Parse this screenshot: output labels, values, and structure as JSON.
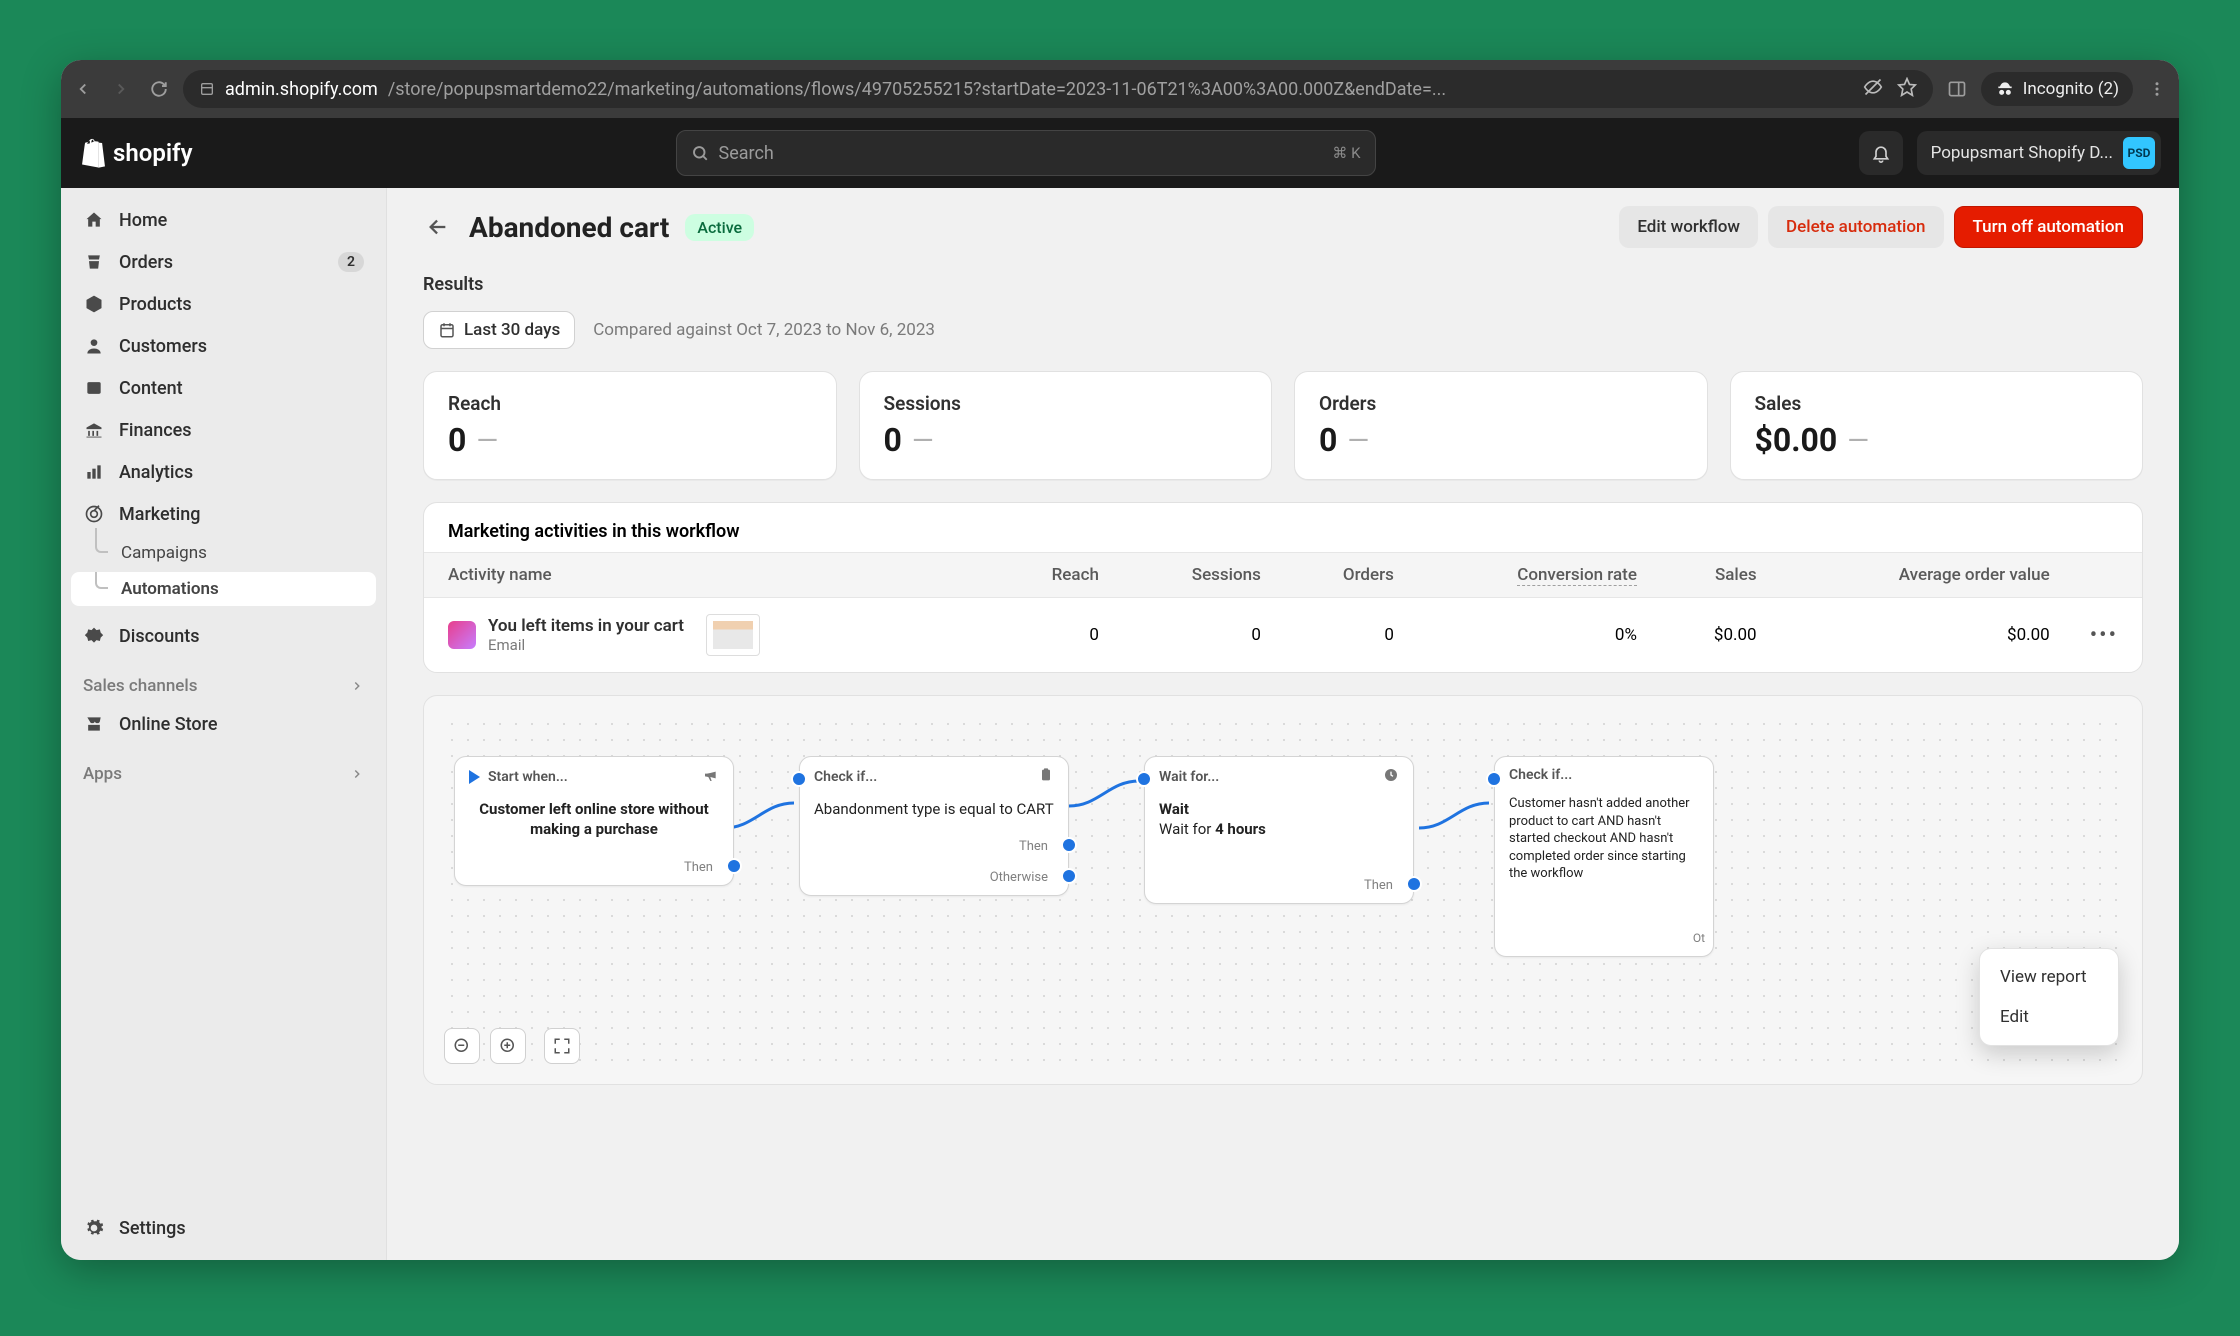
{
  "browser": {
    "url_host": "admin.shopify.com",
    "url_path": "/store/popupsmartdemo22/marketing/automations/flows/49705255215?startDate=2023-11-06T21%3A00%3A00.000Z&endDate=...",
    "incognito": "Incognito (2)"
  },
  "topbar": {
    "logo_text": "shopify",
    "search_placeholder": "Search",
    "shortcut": "⌘ K",
    "store_name": "Popupsmart Shopify D...",
    "store_initials": "PSD"
  },
  "sidebar": {
    "items": [
      {
        "label": "Home"
      },
      {
        "label": "Orders",
        "badge": "2"
      },
      {
        "label": "Products"
      },
      {
        "label": "Customers"
      },
      {
        "label": "Content"
      },
      {
        "label": "Finances"
      },
      {
        "label": "Analytics"
      },
      {
        "label": "Marketing",
        "children": [
          {
            "label": "Campaigns"
          },
          {
            "label": "Automations",
            "active": true
          }
        ]
      },
      {
        "label": "Discounts"
      }
    ],
    "sales_channels_label": "Sales channels",
    "online_store": "Online Store",
    "apps_label": "Apps",
    "settings": "Settings"
  },
  "page": {
    "title": "Abandoned cart",
    "status": "Active",
    "actions": {
      "edit": "Edit workflow",
      "delete": "Delete automation",
      "turn_off": "Turn off automation"
    },
    "results_label": "Results",
    "date_filter": "Last 30 days",
    "compare_text": "Compared against Oct 7, 2023 to Nov 6, 2023",
    "metrics": [
      {
        "title": "Reach",
        "value": "0"
      },
      {
        "title": "Sessions",
        "value": "0"
      },
      {
        "title": "Orders",
        "value": "0"
      },
      {
        "title": "Sales",
        "value": "$0.00"
      }
    ],
    "activities": {
      "title": "Marketing activities in this workflow",
      "columns": [
        "Activity name",
        "Reach",
        "Sessions",
        "Orders",
        "Conversion rate",
        "Sales",
        "Average order value"
      ],
      "rows": [
        {
          "name": "You left items in your cart",
          "sub": "Email",
          "reach": "0",
          "sessions": "0",
          "orders": "0",
          "conversion": "0%",
          "sales": "$0.00",
          "aov": "$0.00"
        }
      ]
    },
    "popup": {
      "view_report": "View report",
      "edit": "Edit"
    },
    "flow": {
      "nodes": [
        {
          "head": "Start when...",
          "body": "Customer left online store without making a purchase",
          "then": "Then"
        },
        {
          "head": "Check if...",
          "body": "Abandonment type is equal to CART",
          "then": "Then",
          "otherwise": "Otherwise"
        },
        {
          "head": "Wait for...",
          "title": "Wait",
          "body": "Wait for 4 hours",
          "then": "Then"
        },
        {
          "head": "Check if...",
          "body": "Customer hasn't added another product to cart AND hasn't started checkout AND hasn't completed order since starting the workflow",
          "otherwise": "Otherwise"
        }
      ]
    }
  }
}
